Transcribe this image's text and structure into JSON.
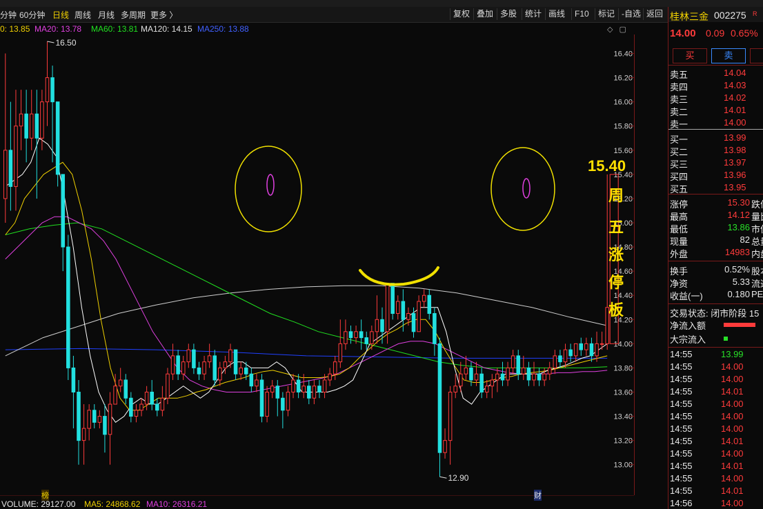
{
  "toolbar": {
    "periods": [
      "分钟",
      "60分钟",
      "日线",
      "周线",
      "月线",
      "多周期",
      "更多 〉"
    ],
    "active_period": "日线",
    "buttons": [
      "复权",
      "叠加",
      "多股",
      "统计",
      "画线",
      "F10",
      "标记",
      "-自选",
      "返回"
    ]
  },
  "ma": {
    "ma10_partial": "0: 13.85",
    "ma20": "MA20: 13.78",
    "ma60": "MA60: 13.81",
    "ma120": "MA120: 14.15",
    "ma250": "MA250: 13.88",
    "colors": {
      "ma5": "#ffffff",
      "ma10": "#f0d000",
      "ma20": "#e040e0",
      "ma60": "#20e020",
      "ma120": "#cfcfcf",
      "ma250": "#2040ff"
    }
  },
  "chart_data": {
    "type": "candlestick",
    "ylim": [
      12.85,
      16.5
    ],
    "y_ticks": [
      "16.40",
      "16.20",
      "16.00",
      "15.80",
      "15.60",
      "15.40",
      "15.20",
      "15.00",
      "14.80",
      "14.60",
      "14.40",
      "14.20",
      "14.00",
      "13.80",
      "13.60",
      "13.40",
      "13.20",
      "13.00"
    ],
    "y_tick_values": [
      16.4,
      16.2,
      16.0,
      15.8,
      15.6,
      15.4,
      15.2,
      15.0,
      14.8,
      14.6,
      14.4,
      14.2,
      14.0,
      13.8,
      13.6,
      13.4,
      13.2,
      13.0
    ],
    "high_label": "16.50",
    "low_label": "12.90",
    "candles": [
      [
        15.2,
        15.6,
        15.0,
        16.4
      ],
      [
        15.6,
        15.3,
        15.1,
        16.0
      ],
      [
        15.3,
        15.8,
        15.1,
        16.1
      ],
      [
        15.8,
        15.9,
        15.6,
        16.1
      ],
      [
        15.9,
        15.7,
        15.5,
        16.1
      ],
      [
        15.7,
        15.9,
        15.6,
        16.1
      ],
      [
        15.9,
        15.7,
        15.2,
        16.1
      ],
      [
        15.7,
        16.0,
        15.6,
        16.1
      ],
      [
        16.0,
        16.2,
        15.8,
        16.5
      ],
      [
        16.2,
        16.0,
        15.5,
        16.3
      ],
      [
        16.0,
        15.4,
        15.3,
        16.0
      ],
      [
        15.4,
        14.8,
        14.6,
        15.4
      ],
      [
        14.8,
        13.8,
        13.7,
        14.9
      ],
      [
        13.8,
        13.6,
        13.3,
        13.9
      ],
      [
        13.6,
        13.2,
        13.0,
        13.7
      ],
      [
        13.2,
        13.3,
        13.0,
        13.5
      ],
      [
        13.3,
        13.45,
        13.2,
        13.5
      ],
      [
        13.45,
        13.35,
        13.3,
        13.5
      ],
      [
        13.35,
        13.4,
        13.3,
        13.45
      ],
      [
        13.4,
        13.25,
        13.1,
        13.5
      ],
      [
        13.25,
        13.5,
        13.0,
        13.6
      ],
      [
        13.5,
        13.65,
        13.5,
        13.75
      ],
      [
        13.65,
        13.7,
        13.6,
        13.8
      ],
      [
        13.7,
        13.55,
        13.5,
        13.75
      ],
      [
        13.55,
        13.4,
        13.35,
        13.6
      ],
      [
        13.4,
        13.45,
        13.35,
        13.5
      ],
      [
        13.45,
        13.5,
        13.4,
        13.55
      ],
      [
        13.5,
        13.6,
        13.45,
        13.65
      ],
      [
        13.6,
        13.5,
        13.45,
        13.7
      ],
      [
        13.5,
        13.45,
        13.4,
        13.55
      ],
      [
        13.45,
        13.55,
        13.4,
        13.65
      ],
      [
        13.55,
        13.75,
        13.5,
        13.8
      ],
      [
        13.75,
        13.9,
        13.7,
        14.0
      ],
      [
        13.9,
        13.75,
        13.7,
        13.95
      ],
      [
        13.75,
        13.85,
        13.7,
        13.9
      ],
      [
        13.85,
        13.95,
        13.8,
        14.0
      ],
      [
        13.95,
        13.8,
        13.75,
        14.0
      ],
      [
        13.8,
        13.75,
        13.7,
        13.85
      ],
      [
        13.75,
        13.85,
        13.7,
        13.9
      ],
      [
        13.85,
        13.9,
        13.8,
        14.0
      ],
      [
        13.9,
        13.7,
        13.65,
        13.95
      ],
      [
        13.7,
        13.8,
        13.65,
        13.85
      ],
      [
        13.8,
        13.85,
        13.75,
        13.9
      ],
      [
        13.85,
        13.95,
        13.8,
        14.0
      ],
      [
        13.95,
        13.75,
        13.7,
        13.95
      ],
      [
        13.75,
        13.8,
        13.7,
        13.85
      ],
      [
        13.8,
        13.75,
        13.7,
        13.85
      ],
      [
        13.75,
        13.65,
        13.6,
        13.8
      ],
      [
        13.65,
        13.7,
        13.6,
        13.75
      ],
      [
        13.7,
        13.4,
        13.35,
        13.75
      ],
      [
        13.4,
        13.6,
        13.35,
        13.65
      ],
      [
        13.6,
        13.65,
        13.55,
        13.7
      ],
      [
        13.65,
        13.55,
        13.4,
        13.7
      ],
      [
        13.55,
        13.45,
        13.3,
        13.6
      ],
      [
        13.45,
        13.6,
        13.4,
        13.65
      ],
      [
        13.6,
        13.7,
        13.55,
        13.75
      ],
      [
        13.7,
        13.6,
        13.55,
        13.75
      ],
      [
        13.6,
        13.65,
        13.55,
        13.75
      ],
      [
        13.65,
        13.55,
        13.5,
        13.7
      ],
      [
        13.55,
        13.65,
        13.5,
        13.7
      ],
      [
        13.65,
        13.6,
        13.55,
        13.7
      ],
      [
        13.6,
        13.7,
        13.55,
        13.75
      ],
      [
        13.7,
        13.75,
        13.65,
        13.8
      ],
      [
        13.75,
        13.85,
        13.7,
        13.9
      ],
      [
        13.85,
        14.0,
        13.8,
        14.2
      ],
      [
        14.0,
        14.1,
        13.95,
        14.2
      ],
      [
        14.1,
        14.05,
        14.0,
        14.15
      ],
      [
        14.05,
        14.1,
        14.0,
        14.15
      ],
      [
        14.1,
        14.05,
        13.95,
        14.2
      ],
      [
        14.05,
        14.0,
        13.95,
        14.1
      ],
      [
        14.0,
        14.1,
        13.95,
        14.15
      ],
      [
        14.1,
        14.2,
        14.0,
        14.4
      ],
      [
        14.2,
        14.1,
        14.0,
        14.3
      ],
      [
        14.1,
        14.5,
        14.0,
        14.5
      ],
      [
        14.5,
        14.25,
        14.2,
        14.5
      ],
      [
        14.25,
        14.35,
        14.2,
        14.4
      ],
      [
        14.35,
        14.2,
        14.1,
        14.45
      ],
      [
        14.2,
        14.25,
        14.15,
        14.3
      ],
      [
        14.25,
        14.1,
        14.05,
        14.3
      ],
      [
        14.1,
        14.35,
        14.1,
        14.4
      ],
      [
        14.35,
        14.4,
        14.3,
        14.45
      ],
      [
        14.4,
        14.25,
        14.2,
        14.45
      ],
      [
        14.25,
        14.0,
        13.9,
        14.3
      ],
      [
        14.0,
        13.1,
        12.9,
        14.05
      ],
      [
        13.1,
        13.2,
        13.05,
        13.3
      ],
      [
        13.2,
        13.6,
        13.0,
        13.65
      ],
      [
        13.6,
        13.65,
        13.55,
        13.75
      ],
      [
        13.65,
        13.75,
        13.6,
        13.85
      ],
      [
        13.75,
        13.8,
        13.7,
        13.9
      ],
      [
        13.8,
        13.7,
        13.65,
        13.85
      ],
      [
        13.7,
        13.75,
        13.65,
        13.85
      ],
      [
        13.75,
        13.6,
        13.55,
        13.8
      ],
      [
        13.6,
        13.65,
        13.55,
        13.7
      ],
      [
        13.65,
        13.7,
        13.55,
        13.75
      ],
      [
        13.7,
        13.75,
        13.6,
        13.8
      ],
      [
        13.75,
        13.7,
        13.65,
        13.85
      ],
      [
        13.7,
        13.8,
        13.65,
        13.85
      ],
      [
        13.8,
        13.9,
        13.75,
        13.95
      ],
      [
        13.9,
        13.75,
        13.7,
        13.95
      ],
      [
        13.75,
        13.8,
        13.7,
        13.9
      ],
      [
        13.8,
        13.7,
        13.65,
        13.85
      ],
      [
        13.7,
        13.75,
        13.65,
        13.85
      ],
      [
        13.75,
        13.7,
        13.65,
        13.8
      ],
      [
        13.7,
        13.75,
        13.65,
        13.8
      ],
      [
        13.75,
        13.8,
        13.7,
        13.85
      ],
      [
        13.8,
        13.9,
        13.75,
        13.95
      ],
      [
        13.9,
        13.85,
        13.8,
        13.95
      ],
      [
        13.85,
        13.95,
        13.8,
        14.0
      ],
      [
        13.95,
        13.9,
        13.85,
        14.0
      ],
      [
        13.9,
        14.0,
        13.85,
        14.0
      ],
      [
        14.0,
        13.95,
        13.9,
        14.05
      ],
      [
        13.95,
        14.0,
        13.9,
        14.05
      ],
      [
        14.0,
        13.9,
        13.85,
        14.05
      ],
      [
        13.9,
        14.0,
        13.85,
        14.1
      ],
      [
        14.0,
        14.0,
        13.95,
        14.1
      ],
      [
        14.0,
        14.3,
        13.95,
        15.4
      ]
    ],
    "ma5": [
      15.3,
      15.35,
      15.4,
      15.5,
      15.7,
      15.65,
      15.55,
      15.2,
      14.8,
      14.3,
      13.9,
      13.6,
      13.45,
      13.35,
      13.4,
      13.5,
      13.55,
      13.5,
      13.5,
      13.55,
      13.6,
      13.65,
      13.6,
      13.55,
      13.6,
      13.7,
      13.8,
      13.85,
      13.85,
      13.8,
      13.8,
      13.8,
      13.85,
      13.8,
      13.7,
      13.6,
      13.6,
      13.6,
      13.6,
      13.62,
      13.65,
      13.7,
      13.85,
      14.0,
      14.05,
      14.1,
      14.15,
      14.2,
      14.25,
      14.3,
      14.3,
      14.3,
      14.1,
      13.8,
      13.55,
      13.5,
      13.6,
      13.65,
      13.7,
      13.75,
      13.75,
      13.75,
      13.75,
      13.75,
      13.78,
      13.8,
      13.82,
      13.85,
      13.88,
      13.9,
      13.95,
      14.0
    ],
    "ma10": [
      14.9,
      15.0,
      15.2,
      15.3,
      15.4,
      15.45,
      15.5,
      15.4,
      15.1,
      14.7,
      14.2,
      13.8,
      13.55,
      13.45,
      13.45,
      13.5,
      13.55,
      13.55,
      13.55,
      13.57,
      13.6,
      13.62,
      13.65,
      13.68,
      13.7,
      13.72,
      13.75,
      13.77,
      13.78,
      13.76,
      13.74,
      13.72,
      13.72,
      13.72,
      13.73,
      13.75,
      13.8,
      13.88,
      13.95,
      14.02,
      14.08,
      14.12,
      14.17,
      14.2,
      14.2,
      14.1,
      13.95,
      13.82,
      13.7,
      13.68,
      13.68,
      13.7,
      13.72,
      13.73,
      13.75,
      13.76,
      13.77,
      13.78,
      13.8,
      13.82,
      13.84,
      13.86,
      13.88,
      13.9
    ],
    "ma20": [
      14.7,
      14.8,
      14.9,
      15.0,
      15.05,
      15.05,
      15.0,
      14.95,
      14.85,
      14.7,
      14.5,
      14.3,
      14.1,
      13.95,
      13.8,
      13.7,
      13.65,
      13.62,
      13.6,
      13.6,
      13.6,
      13.62,
      13.64,
      13.66,
      13.68,
      13.7,
      13.72,
      13.75,
      13.8,
      13.85,
      13.9,
      13.95,
      14.0,
      14.02,
      14.02,
      14.0,
      13.95,
      13.9,
      13.85,
      13.8,
      13.78,
      13.76,
      13.75,
      13.75,
      13.75,
      13.76,
      13.76,
      13.77,
      13.77,
      13.78
    ],
    "ma60": [
      14.9,
      14.95,
      14.98,
      15.0,
      14.95,
      14.85,
      14.75,
      14.65,
      14.55,
      14.45,
      14.35,
      14.25,
      14.18,
      14.1,
      14.05,
      14.0,
      13.95,
      13.9,
      13.85,
      13.82,
      13.8,
      13.8,
      13.8,
      13.8,
      13.8,
      13.81
    ],
    "ma120": [
      13.9,
      14.05,
      14.15,
      14.25,
      14.32,
      14.38,
      14.42,
      14.45,
      14.47,
      14.48,
      14.48,
      14.46,
      14.42,
      14.36,
      14.3,
      14.22,
      14.15
    ],
    "ma250": [
      13.95,
      13.96,
      13.95,
      13.93,
      13.9,
      13.89,
      13.88,
      13.88,
      13.88
    ]
  },
  "annotations": {
    "price": "15.40",
    "chars": [
      "周",
      "五",
      "涨",
      "停",
      "板"
    ]
  },
  "volume_bar": {
    "volume": "VOLUME: 29127.00",
    "ma5": "MA5: 24868.62",
    "ma10": "MA10: 26316.21",
    "marker_bang": "榜",
    "marker_cai": "财"
  },
  "panel": {
    "name": "桂林三金",
    "code": "002275",
    "tag": "R",
    "price": "14.00",
    "change": "0.09",
    "pct": "0.65%",
    "buy": "买",
    "sell": "卖",
    "asks": [
      [
        "卖五",
        "14.04"
      ],
      [
        "卖四",
        "14.03"
      ],
      [
        "卖三",
        "14.02"
      ],
      [
        "卖二",
        "14.01"
      ],
      [
        "卖一",
        "14.00"
      ]
    ],
    "bids": [
      [
        "买一",
        "13.99"
      ],
      [
        "买二",
        "13.98"
      ],
      [
        "买三",
        "13.97"
      ],
      [
        "买四",
        "13.96"
      ],
      [
        "买五",
        "13.95"
      ]
    ],
    "stats": [
      {
        "l": "涨停",
        "v": "15.30",
        "c": "red",
        "r": "跌停"
      },
      {
        "l": "最高",
        "v": "14.12",
        "c": "red",
        "r": "量比"
      },
      {
        "l": "最低",
        "v": "13.86",
        "c": "green",
        "r": "市值"
      },
      {
        "l": "现量",
        "v": "82",
        "c": "white",
        "r": "总量"
      },
      {
        "l": "外盘",
        "v": "14983",
        "c": "red",
        "r": "内盘"
      }
    ],
    "stats2": [
      {
        "l": "换手",
        "v": "0.52%",
        "r": "股本"
      },
      {
        "l": "净资",
        "v": "5.33",
        "r": "流通"
      },
      {
        "l": "收益(一)",
        "v": "0.180",
        "r": "PE"
      }
    ],
    "trade_status": "交易状态: 闭市阶段 15",
    "net_inflow": "净流入额",
    "block_inflow": "大宗流入",
    "ticks": [
      [
        "14:55",
        "13.99",
        "green"
      ],
      [
        "14:55",
        "14.00",
        "red"
      ],
      [
        "14:55",
        "14.00",
        "red"
      ],
      [
        "14:55",
        "14.01",
        "red"
      ],
      [
        "14:55",
        "14.00",
        "red"
      ],
      [
        "14:55",
        "14.00",
        "red"
      ],
      [
        "14:55",
        "14.00",
        "red"
      ],
      [
        "14:55",
        "14.01",
        "red"
      ],
      [
        "14:55",
        "14.00",
        "red"
      ],
      [
        "14:55",
        "14.01",
        "red"
      ],
      [
        "14:55",
        "14.00",
        "red"
      ],
      [
        "14:55",
        "14.01",
        "red"
      ],
      [
        "14:56",
        "14.00",
        "red"
      ]
    ]
  }
}
